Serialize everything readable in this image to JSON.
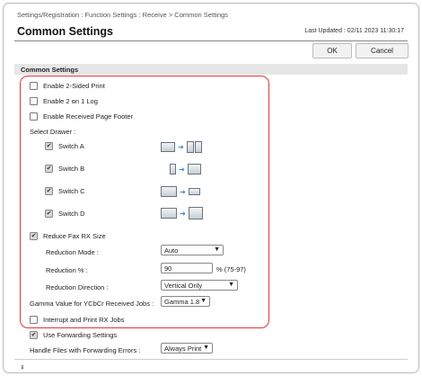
{
  "header": {
    "breadcrumb": "Settings/Registration : Function Settings : Receive > Common Settings",
    "title": "Common Settings",
    "last_updated": "Last Updated : 02/11 2023 11:30:17",
    "ok_label": "OK",
    "cancel_label": "Cancel"
  },
  "section": {
    "title": "Common Settings"
  },
  "options": {
    "two_sided": {
      "label": "Enable 2-Sided Print",
      "checked": false
    },
    "two_on_one": {
      "label": "Enable 2 on 1 Log",
      "checked": false
    },
    "page_footer": {
      "label": "Enable Received Page Footer",
      "checked": false
    },
    "select_drawer": "Select Drawer :",
    "switches": [
      {
        "label": "Switch A",
        "checked": true,
        "icon": "drawer-switch-a-icon"
      },
      {
        "label": "Switch B",
        "checked": true,
        "icon": "drawer-switch-b-icon"
      },
      {
        "label": "Switch C",
        "checked": true,
        "icon": "drawer-switch-c-icon"
      },
      {
        "label": "Switch D",
        "checked": true,
        "icon": "drawer-switch-d-icon"
      }
    ],
    "reduce_fax": {
      "label": "Reduce Fax RX Size",
      "checked": true
    },
    "reduction_mode": {
      "label": "Reduction Mode :",
      "value": "Auto"
    },
    "reduction_percent": {
      "label": "Reduction % :",
      "value": "90",
      "range": "% (75-97)"
    },
    "reduction_direction": {
      "label": "Reduction Direction :",
      "value": "Vertical Only"
    },
    "gamma": {
      "label": "Gamma Value for YCbCr Received Jobs :",
      "value": "Gamma 1.8"
    },
    "interrupt": {
      "label": "Interrupt and Print RX Jobs",
      "checked": false
    },
    "forwarding": {
      "label": "Use Forwarding Settings",
      "checked": true
    },
    "forward_errors": {
      "label": "Handle Files with Forwarding Errors :",
      "value": "Always Print"
    }
  },
  "colors": {
    "highlight": "#e0353a",
    "arrow": "#2f86d6",
    "section_bar": "#e6e6e6"
  }
}
